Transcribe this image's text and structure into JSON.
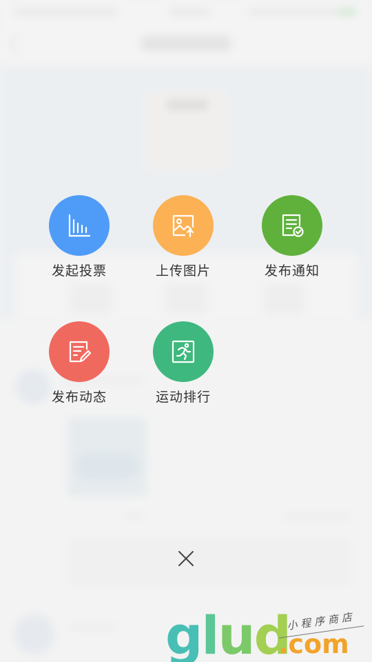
{
  "actions": [
    {
      "label": "发起投票",
      "icon": "bar-chart-icon",
      "color": "#4f9bf8"
    },
    {
      "label": "上传图片",
      "icon": "image-upload-icon",
      "color": "#fbb154"
    },
    {
      "label": "发布通知",
      "icon": "notice-check-icon",
      "color": "#5fb13c"
    },
    {
      "label": "发布动态",
      "icon": "edit-post-icon",
      "color": "#f0695f"
    },
    {
      "label": "运动排行",
      "icon": "running-icon",
      "color": "#3eb87e"
    }
  ],
  "close": {
    "icon": "close-icon"
  },
  "watermark": {
    "logo": "glud",
    "domain": ".com",
    "tagline": "小程序商店",
    "colors": [
      "#48bfb4",
      "#5cc695",
      "#7cc96a",
      "#a3cf52",
      "#f2a32b"
    ]
  }
}
